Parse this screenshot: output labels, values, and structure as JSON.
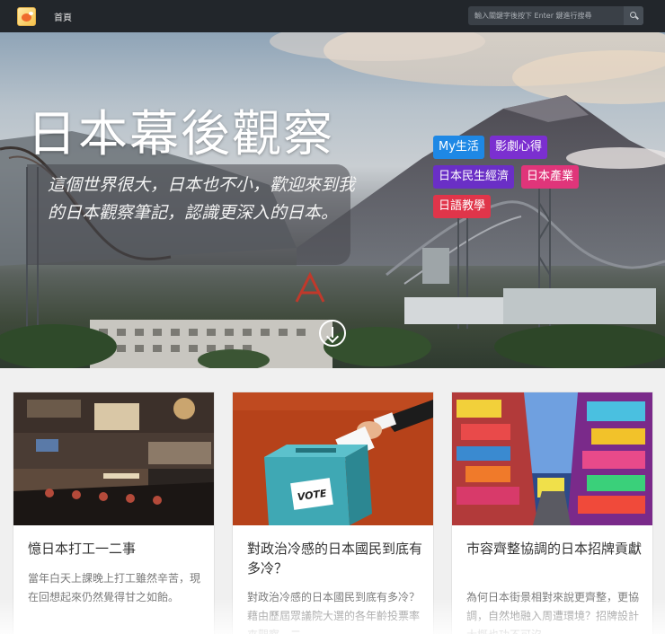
{
  "navbar": {
    "home_label": "首頁",
    "search_placeholder": "輸入關鍵字後按下 Enter 鍵進行搜尋"
  },
  "hero": {
    "title": "日本幕後觀察",
    "subtitle": "這個世界很大，日本也不小，歡迎來到我的日本觀察筆記，認識更深入的日本。",
    "tags": [
      {
        "label": "My生活",
        "color": "#1e88e5"
      },
      {
        "label": "影劇心得",
        "color": "#7b2fd0"
      },
      {
        "label": "日本民生經濟",
        "color": "#6a2fc6"
      },
      {
        "label": "日本產業",
        "color": "#e0357a"
      },
      {
        "label": "日語教學",
        "color": "#e0354a"
      }
    ]
  },
  "cards": [
    {
      "title": "憶日本打工一二事",
      "excerpt": "當年白天上課晚上打工雖然辛苦，現在回想起來仍然覺得甘之如飴。"
    },
    {
      "title": "對政治冷感的日本國民到底有多冷？",
      "excerpt": "對政治冷感的日本國民到底有多冷？藉由歷屆眾議院大選的各年齡投票率來觀察一二。"
    },
    {
      "title": "市容齊整協調的日本招牌貢獻",
      "excerpt": "為何日本街景相對來說更齊整，更協調，自然地融入周遭環境？招牌設計大概也功不可沒。"
    }
  ],
  "image_text": {
    "vote_box": "VOTE"
  },
  "colors": {
    "navbar_bg": "#22262b",
    "vote_bg": "#b6421a",
    "ballot_box": "#3fa8b4"
  },
  "icons": [
    "site-logo-icon",
    "search-icon",
    "arrow-down-circle-icon"
  ]
}
